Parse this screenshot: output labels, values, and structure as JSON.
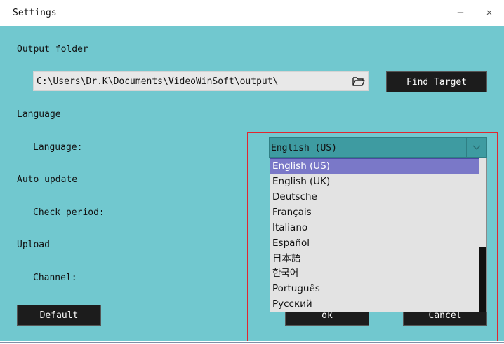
{
  "window": {
    "title": "Settings",
    "minimize_glyph": "—",
    "close_glyph": "✕"
  },
  "sections": {
    "output_folder": {
      "heading": "Output folder",
      "path_value": "C:\\Users\\Dr.K\\Documents\\VideoWinSoft\\output\\",
      "find_target_label": "Find Target",
      "folder_icon": "folder-open-icon"
    },
    "language": {
      "heading": "Language",
      "field_label": "Language:",
      "selected": "English (US)",
      "options": [
        "English (US)",
        "English (UK)",
        "Deutsche",
        "Français",
        "Italiano",
        "Español",
        "日本語",
        "한국어",
        "Português",
        "Русский"
      ]
    },
    "auto_update": {
      "heading": "Auto update",
      "field_label": "Check period:"
    },
    "upload": {
      "heading": "Upload",
      "field_label": "Channel:"
    }
  },
  "buttons": {
    "default_label": "Default",
    "ok_label": "ok",
    "cancel_label": "Cancel"
  },
  "colors": {
    "panel_bg": "#71c8cf",
    "combo_bg": "#3e9ba1",
    "selected_item_bg": "#7a78c8",
    "button_bg": "#1c1c1c",
    "highlight_frame": "#e0262f"
  }
}
